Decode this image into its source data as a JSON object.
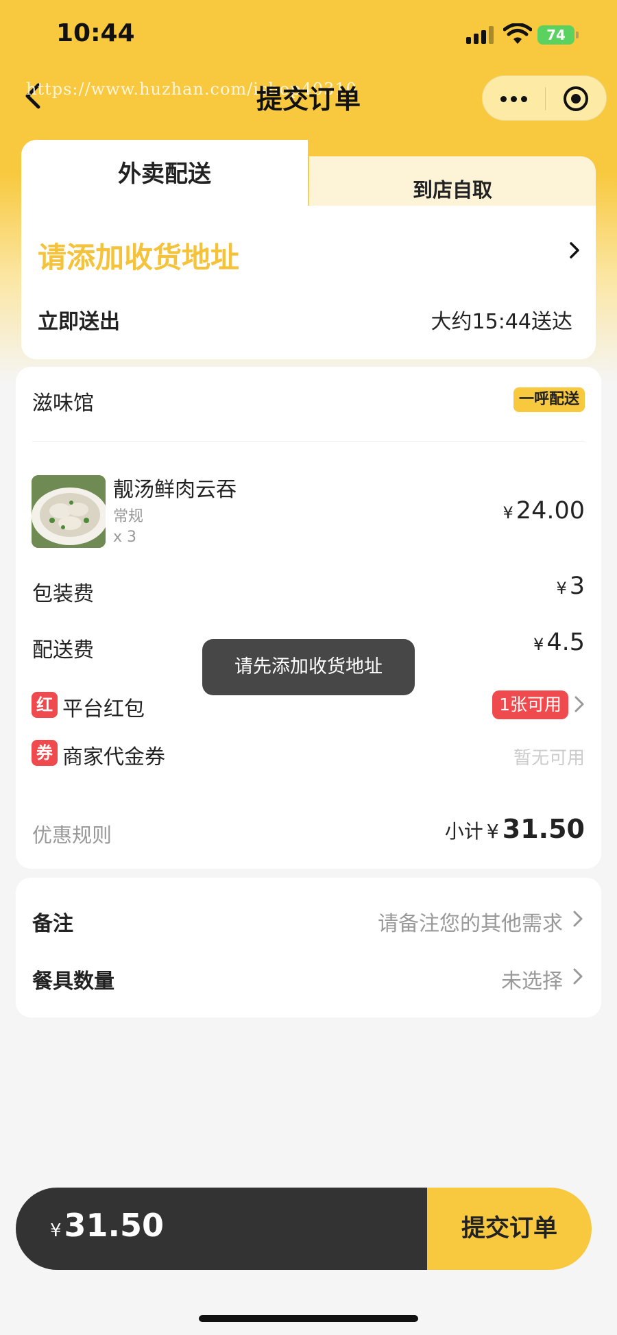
{
  "status_bar": {
    "time": "10:44",
    "battery": "74"
  },
  "nav": {
    "watermark": "https://www.huzhan.com/ishop40310",
    "title": "提交订单"
  },
  "delivery": {
    "tab_delivery": "外卖配送",
    "tab_pickup": "到店自取",
    "address_prompt": "请添加收货地址",
    "send_now": "立即送出",
    "eta": "大约15:44送达"
  },
  "order": {
    "shop_name": "滋味馆",
    "shop_badge": "一呼配送",
    "item": {
      "name": "靓汤鲜肉云吞",
      "spec": "常规",
      "qty": "x 3",
      "currency": "¥",
      "price": "24.00"
    },
    "packaging": {
      "label": "包装费",
      "currency": "¥",
      "value": "3"
    },
    "delivery_fee": {
      "label": "配送费",
      "currency": "¥",
      "value": "4.5"
    },
    "red_packet": {
      "tag": "红",
      "label": "平台红包",
      "status": "1张可用"
    },
    "voucher": {
      "tag": "券",
      "label": "商家代金券",
      "status": "暂无可用"
    },
    "rules": "优惠规则",
    "subtotal_label": "小计",
    "subtotal_currency": "¥",
    "subtotal_value": "31.50"
  },
  "toast": "请先添加收货地址",
  "remarks": {
    "note_label": "备注",
    "note_placeholder": "请备注您的其他需求",
    "cutlery_label": "餐具数量",
    "cutlery_value": "未选择"
  },
  "footer": {
    "currency": "¥",
    "total": "31.50",
    "submit_label": "提交订单"
  },
  "colors": {
    "brand_yellow": "#f8c93e",
    "promo_red": "#ef4a4d",
    "dark_bar": "#333333"
  },
  "icons": [
    "back-arrow-icon",
    "more-dots-icon",
    "close-target-icon",
    "chevron-right-icon",
    "signal-icon",
    "wifi-icon",
    "battery-icon"
  ]
}
